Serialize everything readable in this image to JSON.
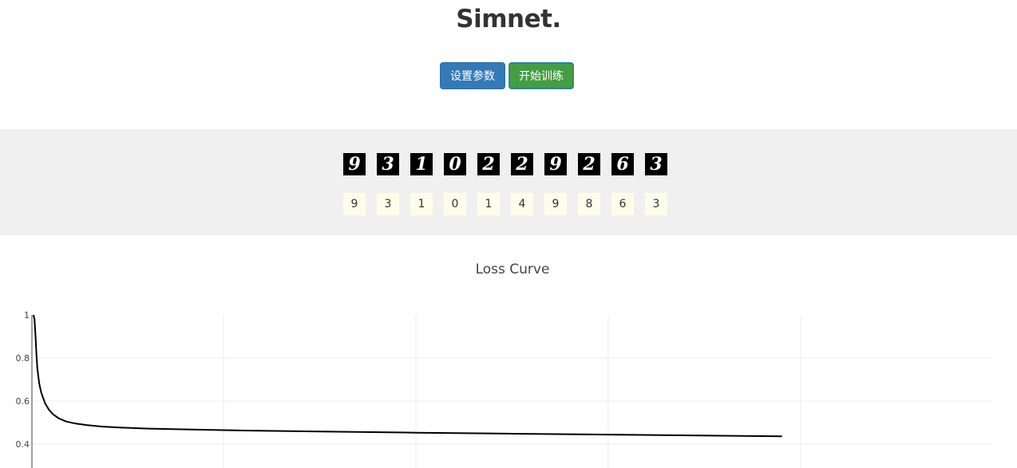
{
  "header": {
    "title": "Simnet."
  },
  "toolbar": {
    "set_params_label": "设置参数",
    "start_training_label": "开始训练"
  },
  "samples": {
    "images": [
      "9",
      "3",
      "1",
      "0",
      "2",
      "2",
      "9",
      "2",
      "6",
      "3"
    ],
    "predictions": [
      "9",
      "3",
      "1",
      "0",
      "1",
      "4",
      "9",
      "8",
      "6",
      "3"
    ]
  },
  "chart_data": {
    "type": "line",
    "title": "Loss Curve",
    "xlabel": "",
    "ylabel": "",
    "ylim": [
      0.3,
      1
    ],
    "yticks": [
      0.4,
      0.6,
      0.8,
      1
    ],
    "yticklabels": [
      "0.4",
      "0.6",
      "0.8",
      "1"
    ],
    "xlim": [
      0,
      5000
    ],
    "grid": true,
    "series": [
      {
        "color": "#000000",
        "x": [
          0,
          5,
          10,
          15,
          20,
          30,
          40,
          60,
          80,
          100,
          130,
          170,
          220,
          280,
          350,
          450,
          600,
          800,
          1100,
          1500,
          2000,
          2500,
          3000,
          3900
        ],
        "values": [
          1.0,
          0.98,
          0.91,
          0.82,
          0.75,
          0.68,
          0.64,
          0.59,
          0.56,
          0.54,
          0.52,
          0.505,
          0.495,
          0.488,
          0.482,
          0.477,
          0.472,
          0.468,
          0.463,
          0.458,
          0.453,
          0.448,
          0.444,
          0.436
        ]
      }
    ],
    "colors": {
      "grid": "#eeeeee",
      "axis": "#444444"
    }
  }
}
